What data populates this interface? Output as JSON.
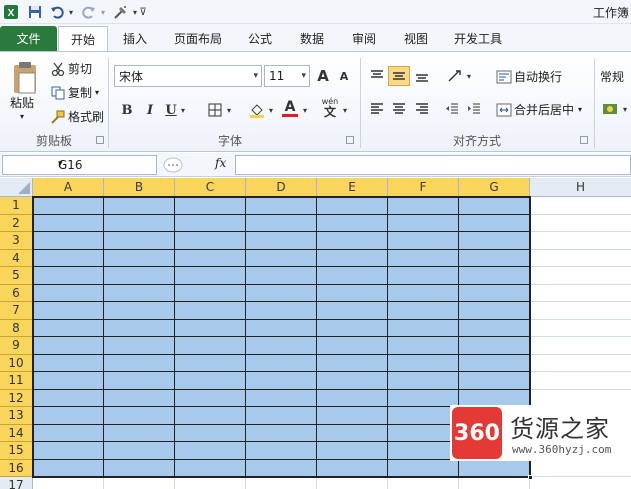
{
  "app": {
    "title": "工作簿",
    "colors": {
      "file_tab": "#2a7a3b",
      "selection_fill": "#a7caec",
      "header_highlight": "#f9d55c"
    }
  },
  "qat": {
    "excel_icon": "excel-icon",
    "save_icon": "save-icon",
    "undo_icon": "undo-icon",
    "redo_icon": "redo-icon",
    "brush_icon": "format-painter-icon"
  },
  "tabs": [
    {
      "label": "文件"
    },
    {
      "label": "开始"
    },
    {
      "label": "插入"
    },
    {
      "label": "页面布局"
    },
    {
      "label": "公式"
    },
    {
      "label": "数据"
    },
    {
      "label": "审阅"
    },
    {
      "label": "视图"
    },
    {
      "label": "开发工具"
    }
  ],
  "ribbon": {
    "clipboard": {
      "label": "剪贴板",
      "paste": "粘贴",
      "cut": "剪切",
      "copy": "复制",
      "format_painter": "格式刷"
    },
    "font": {
      "label": "字体",
      "font_name": "宋体",
      "font_size": "11",
      "grow": "A",
      "shrink": "A",
      "bold": "B",
      "italic": "I",
      "underline": "U",
      "font_color_letter": "A",
      "wen": "wén"
    },
    "alignment": {
      "label": "对齐方式",
      "wrap": "自动换行",
      "merge": "合并后居中"
    },
    "number": {
      "format": "常规"
    }
  },
  "formula_bar": {
    "name_box": "G16",
    "fx": "fx",
    "formula": ""
  },
  "grid": {
    "columns": [
      "A",
      "B",
      "C",
      "D",
      "E",
      "F",
      "G",
      "H"
    ],
    "rows": [
      "1",
      "2",
      "3",
      "4",
      "5",
      "6",
      "7",
      "8",
      "9",
      "10",
      "11",
      "12",
      "13",
      "14",
      "15",
      "16",
      "17"
    ],
    "selected_columns": 7,
    "selected_rows": 16
  },
  "watermark": {
    "logo": "360",
    "name": "货源之家",
    "url": "www.360hyzj.com"
  }
}
